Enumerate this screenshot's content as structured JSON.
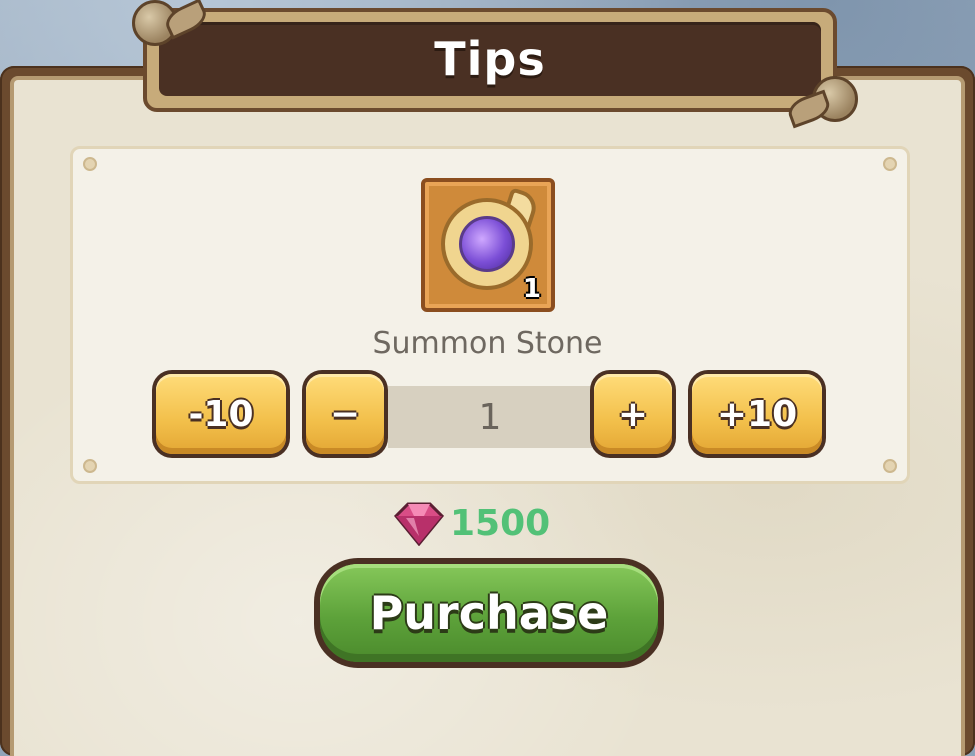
{
  "dialog": {
    "title": "Tips"
  },
  "item": {
    "name": "Summon Stone",
    "icon": "summon-stone-icon",
    "count": "1"
  },
  "stepper": {
    "minus10_label": "-10",
    "minus1_label": "−",
    "quantity": "1",
    "plus1_label": "+",
    "plus10_label": "+10"
  },
  "price": {
    "currency_icon": "gem-icon",
    "amount": "1500"
  },
  "purchase": {
    "label": "Purchase"
  },
  "colors": {
    "price_text": "#52c177",
    "button_yellow": "#f2bf4a",
    "button_green": "#5da23a",
    "title_bar": "#4a3023"
  }
}
